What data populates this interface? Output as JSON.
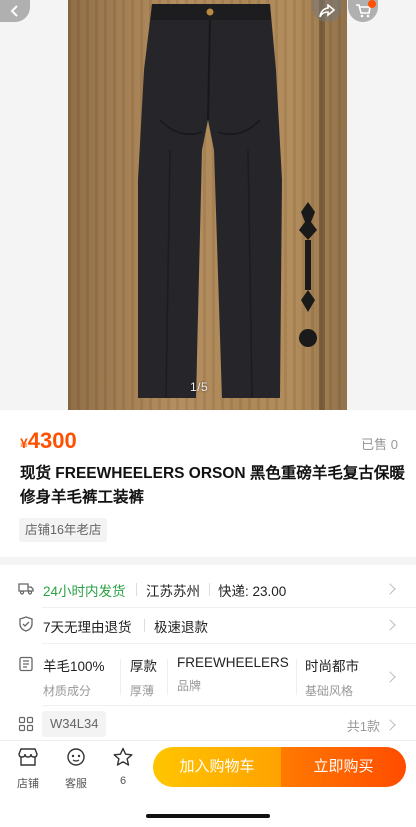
{
  "gallery": {
    "pager": "1/5"
  },
  "product": {
    "currency": "¥",
    "price": "4300",
    "sold": "已售 0",
    "title": "现货 FREEWHEELERS ORSON 黑色重磅羊毛复古保暖修身羊毛裤工装裤",
    "shop_tag": "店铺16年老店"
  },
  "shipping": {
    "icon": "truck-icon",
    "time": "24小时内发货",
    "origin": "江苏苏州",
    "fee": "快递: 23.00"
  },
  "service": {
    "icon": "shield-check-icon",
    "returns": "7天无理由退货",
    "refund": "极速退款"
  },
  "attributes": {
    "icon": "list-icon",
    "items": [
      {
        "value": "羊毛100%",
        "key": "材质成分"
      },
      {
        "value": "厚款",
        "key": "厚薄"
      },
      {
        "value": "FREEWHEELERS",
        "key": "品牌"
      },
      {
        "value": "时尚都市",
        "key": "基础风格"
      }
    ]
  },
  "sku": {
    "icon": "grid-icon",
    "selected": "W34L34",
    "count": "共1款"
  },
  "bottom_bar": {
    "shop_label": "店铺",
    "service_label": "客服",
    "fav_count": "6",
    "add_to_cart": "加入购物车",
    "buy_now": "立即购买"
  },
  "colors": {
    "accent": "#ff5000",
    "green": "#2ba245",
    "cart_btn": "#ffb300",
    "buy_btn": "#ff5a00"
  }
}
